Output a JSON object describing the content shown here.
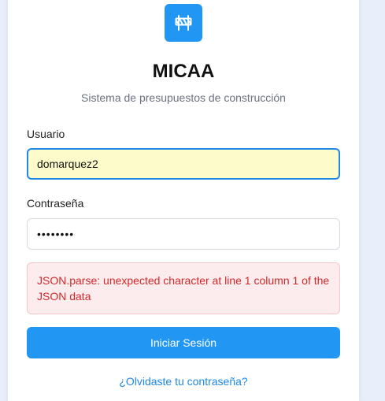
{
  "app": {
    "title": "MICAA",
    "subtitle": "Sistema de presupuestos de construcción",
    "logo_icon": "road-barrier-icon"
  },
  "form": {
    "username_label": "Usuario",
    "username_value": "domarquez2",
    "password_label": "Contraseña",
    "password_value": "••••••••",
    "error_message": "JSON.parse: unexpected character at line 1 column 1 of the JSON data",
    "submit_label": "Iniciar Sesión",
    "forgot_link": "¿Olvidaste tu contraseña?"
  },
  "colors": {
    "primary": "#2196f3",
    "autofill_bg": "#fdfbc9",
    "error_text": "#d42828",
    "error_bg": "#fdecee",
    "page_bg": "#e9eefb"
  }
}
